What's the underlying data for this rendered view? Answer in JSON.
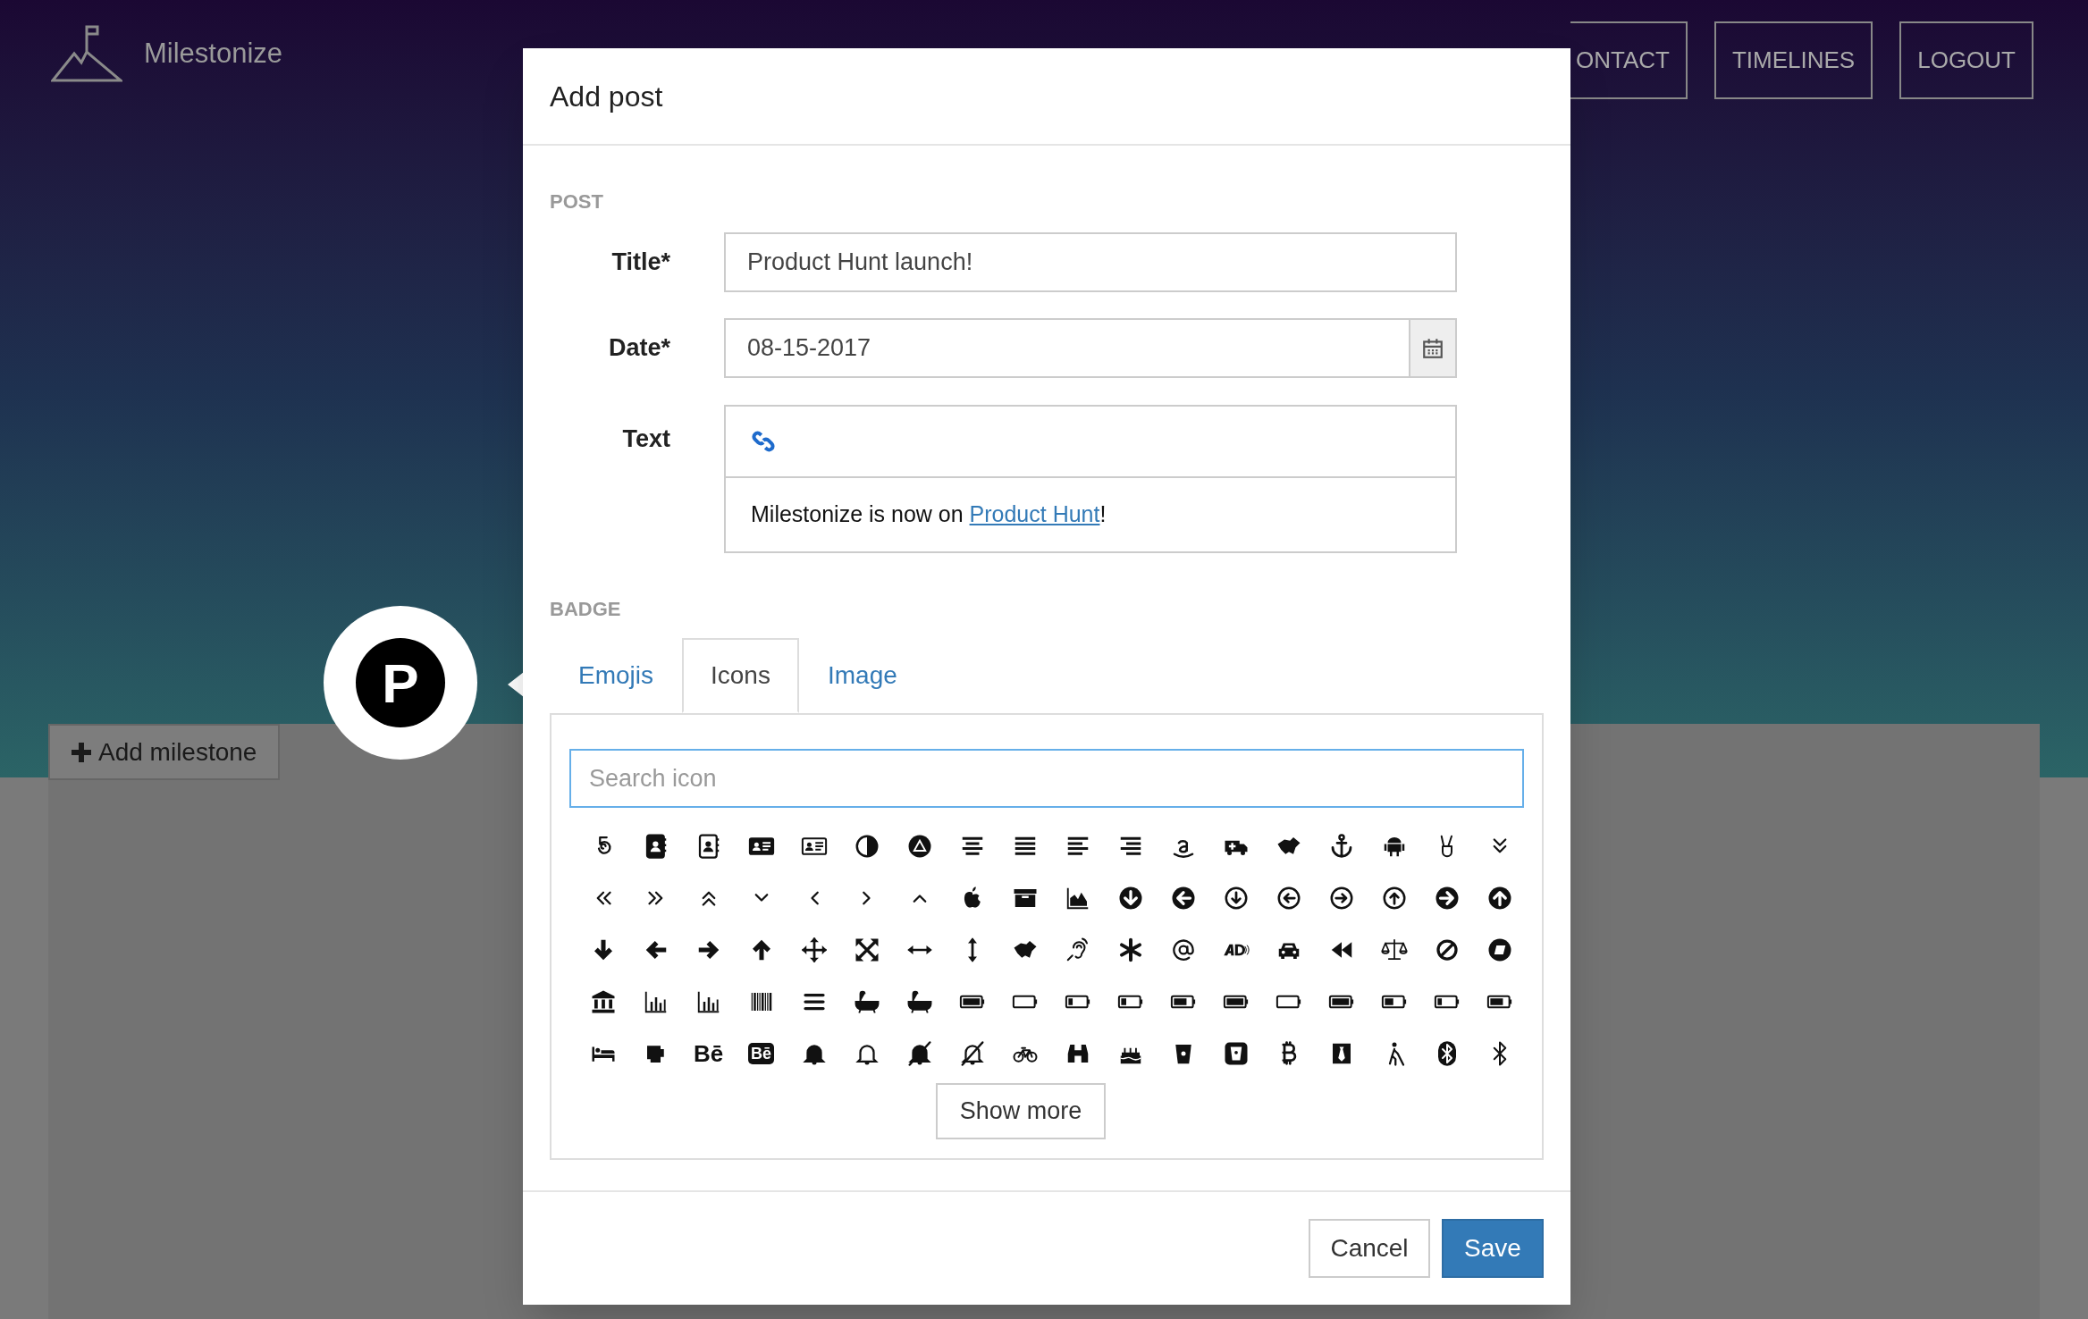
{
  "app": {
    "name": "Milestonize"
  },
  "nav": [
    {
      "label": "ONTACT"
    },
    {
      "label": "TIMELINES"
    },
    {
      "label": "LOGOUT"
    }
  ],
  "milestone_button": {
    "label": "Add milestone"
  },
  "badge_preview": {
    "letter": "P"
  },
  "modal": {
    "title": "Add post",
    "post_section": {
      "heading": "POST",
      "title_label": "Title*",
      "title_value": "Product Hunt launch!",
      "date_label": "Date*",
      "date_value": "08-15-2017",
      "text_label": "Text",
      "text_before_link": "Milestonize is now on ",
      "text_link": "Product Hunt",
      "text_after_link": "!"
    },
    "badge_section": {
      "heading": "BADGE",
      "tabs": [
        {
          "label": "Emojis",
          "selected": false
        },
        {
          "label": "Icons",
          "selected": true
        },
        {
          "label": "Image",
          "selected": false
        }
      ],
      "search": {
        "placeholder": "Search icon"
      },
      "glyph_icons": [
        "Bē",
        "Bē"
      ],
      "show_more": "Show more"
    },
    "buttons": {
      "cancel": "Cancel",
      "save": "Save"
    }
  }
}
